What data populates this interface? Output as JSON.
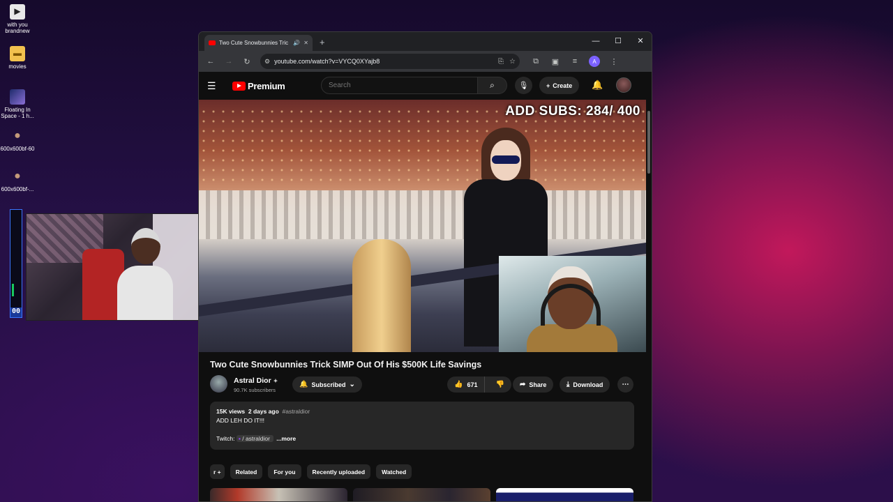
{
  "desktop": {
    "icons": [
      {
        "label": "with you brandnew",
        "icon": "video-file-icon"
      },
      {
        "label": "movies",
        "icon": "folder-icon"
      },
      {
        "label": "Floating In Space - 1 h...",
        "icon": "image-file-icon"
      },
      {
        "label": "600x600bf-60",
        "icon": "image-file-icon"
      },
      {
        "label": "600x600bf-...",
        "icon": "image-file-icon"
      }
    ],
    "meter_value": "00"
  },
  "browser": {
    "tab_title": "Two Cute Snowbunnies Tric",
    "url": "youtube.com/watch?v=VYCQ0XYajb8"
  },
  "youtube": {
    "logo_text": "Premium",
    "search_placeholder": "Search",
    "create_label": "Create",
    "video_overlay_text": "ADD SUBS: 284/ 400",
    "video_title": "Two Cute Snowbunnies Trick SIMP Out Of His $500K Life Savings",
    "channel": {
      "name": "Astral Dior",
      "badge": "✦",
      "subscribers": "90.7K subscribers"
    },
    "subscribed_label": "Subscribed",
    "likes": "671",
    "share_label": "Share",
    "download_label": "Download",
    "description": {
      "views": "15K views",
      "date": "2 days ago",
      "hashtag": "#astraldior",
      "line1": "ADD LEH DO IT!!!",
      "twitch_prefix": "Twitch:",
      "twitch_link": "/ astraldior",
      "more": "...more"
    },
    "chips": [
      "r +",
      "Related",
      "For you",
      "Recently uploaded",
      "Watched"
    ]
  },
  "colors": {
    "yt_red": "#ff0000",
    "yt_bg": "#0f0f0f",
    "chip_bg": "#272727"
  }
}
